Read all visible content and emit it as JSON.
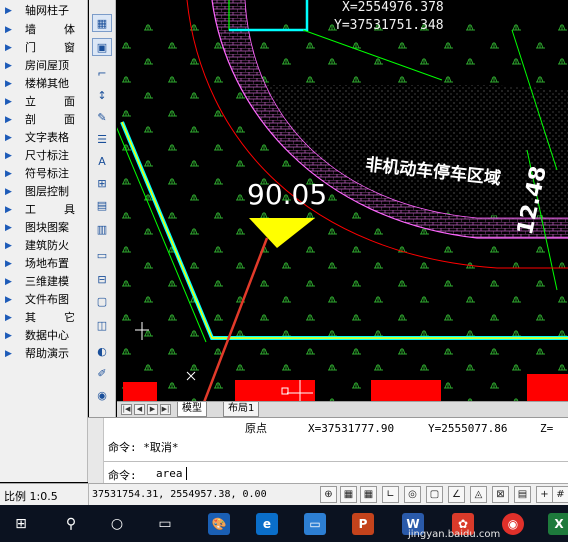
{
  "menu": {
    "items": [
      {
        "label": "轴网柱子"
      },
      {
        "label": "墙　　体"
      },
      {
        "label": "门　　窗"
      },
      {
        "label": "房间屋顶"
      },
      {
        "label": "楼梯其他"
      },
      {
        "label": "立　　面"
      },
      {
        "label": "剖　　面"
      },
      {
        "label": "文字表格"
      },
      {
        "label": "尺寸标注"
      },
      {
        "label": "符号标注"
      },
      {
        "label": "图层控制"
      },
      {
        "label": "工　　具"
      },
      {
        "label": "图块图案"
      },
      {
        "label": "建筑防火"
      },
      {
        "label": "场地布置"
      },
      {
        "label": "三维建模"
      },
      {
        "label": "文件布图"
      },
      {
        "label": "其　　它"
      },
      {
        "label": "数据中心"
      },
      {
        "label": "帮助演示"
      }
    ]
  },
  "canvas": {
    "coord_x": "X=2554976.378",
    "coord_y": "Y=37531751.348",
    "area_label": "非机动车停车区域",
    "dim_value": "90.05",
    "side_value": "12.48",
    "colors": {
      "green": "#00ff00",
      "cyan": "#00ffff",
      "yellow": "#ffff00",
      "magenta": "#d070d0",
      "red": "#ff0000",
      "arrow": "#e23a2a"
    }
  },
  "tabs": {
    "model": "模型",
    "layout1": "布局1"
  },
  "command": {
    "origin_label": "原点",
    "origin_x": "X=37531777.90",
    "origin_y": "Y=2555077.86",
    "origin_z": "Z=",
    "history_line": "命令: *取消*",
    "prompt_label": "命令:",
    "prompt_value": "area"
  },
  "status": {
    "scale": "比例 1:0.5",
    "coords": "37531754.31, 2554957.38, 0.00"
  },
  "taskbar": {
    "watermark": "jingyan.baidu.com"
  }
}
